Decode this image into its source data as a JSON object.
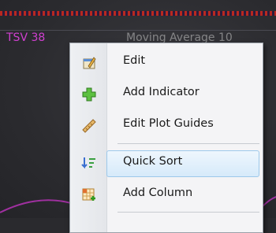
{
  "chart": {
    "indicator_label": "TSV 38",
    "indicator_label_right": "Moving Average 10"
  },
  "context_menu": {
    "items": [
      {
        "label": "Edit",
        "icon": "edit-icon"
      },
      {
        "label": "Add Indicator",
        "icon": "add-plus-icon"
      },
      {
        "label": "Edit Plot Guides",
        "icon": "ruler-icon"
      },
      {
        "label": "Quick Sort",
        "icon": "sort-icon",
        "highlighted": true
      },
      {
        "label": "Add Column",
        "icon": "add-column-icon"
      }
    ]
  },
  "colors": {
    "indicator": "#d040d0",
    "menu_background": "#f4f4f6",
    "highlight_border": "#9cc8ea"
  }
}
